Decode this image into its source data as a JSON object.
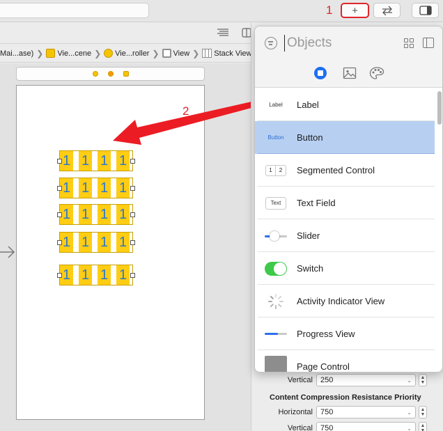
{
  "toolbar": {
    "add_library_label": "+",
    "swap_icon": "swap-arrows-icon",
    "panel_icon": "inspector-toggle-icon"
  },
  "annotations": {
    "one": "1",
    "two": "2"
  },
  "jump_bar": {
    "crumbs": [
      {
        "label": "Mai...ase)",
        "icon": "storyboard-icon"
      },
      {
        "label": "Vie...cene",
        "icon": "scene-icon",
        "color": "#f5c400"
      },
      {
        "label": "Vie...roller",
        "icon": "view-controller-icon",
        "color": "#f5c400"
      },
      {
        "label": "View",
        "icon": "view-icon",
        "color": "#8f8f8f"
      },
      {
        "label": "Stack View",
        "icon": "stack-view-icon",
        "color": "#8f8f8f"
      }
    ]
  },
  "canvas": {
    "button_rows": [
      [
        "1",
        "1",
        "1",
        "1"
      ],
      [
        "1",
        "1",
        "1",
        "1"
      ],
      [
        "1",
        "1",
        "1",
        "1"
      ],
      [
        "1",
        "1",
        "1",
        "1"
      ],
      [
        "1",
        "1",
        "1",
        "1"
      ]
    ]
  },
  "library": {
    "search_placeholder": "Objects",
    "items": [
      {
        "name": "Label",
        "thumb": "Label",
        "selected": false
      },
      {
        "name": "Button",
        "thumb": "Button",
        "selected": true
      },
      {
        "name": "Segmented Control",
        "thumb_seg": [
          "1",
          "2"
        ],
        "selected": false
      },
      {
        "name": "Text Field",
        "thumb": "Text",
        "selected": false
      },
      {
        "name": "Slider",
        "slider_value": 0.45,
        "selected": false
      },
      {
        "name": "Switch",
        "switch_on": true,
        "selected": false
      },
      {
        "name": "Activity Indicator View",
        "selected": false
      },
      {
        "name": "Progress View",
        "progress_value": 0.6,
        "selected": false
      },
      {
        "name": "Page Control",
        "selected": false
      }
    ]
  },
  "inspector": {
    "hugging_vertical": {
      "label": "Vertical",
      "value": "250"
    },
    "compression_heading": "Content Compression Resistance Priority",
    "compression_horizontal": {
      "label": "Horizontal",
      "value": "750"
    },
    "compression_vertical": {
      "label": "Vertical",
      "value": "750"
    }
  },
  "colors": {
    "annotation_red": "#e0242a",
    "button_fill": "#ffcd13",
    "button_text": "#2e76c9",
    "selection": "#b7d0f2",
    "accent_blue": "#1d6ff2",
    "switch_green": "#3dc94a"
  }
}
